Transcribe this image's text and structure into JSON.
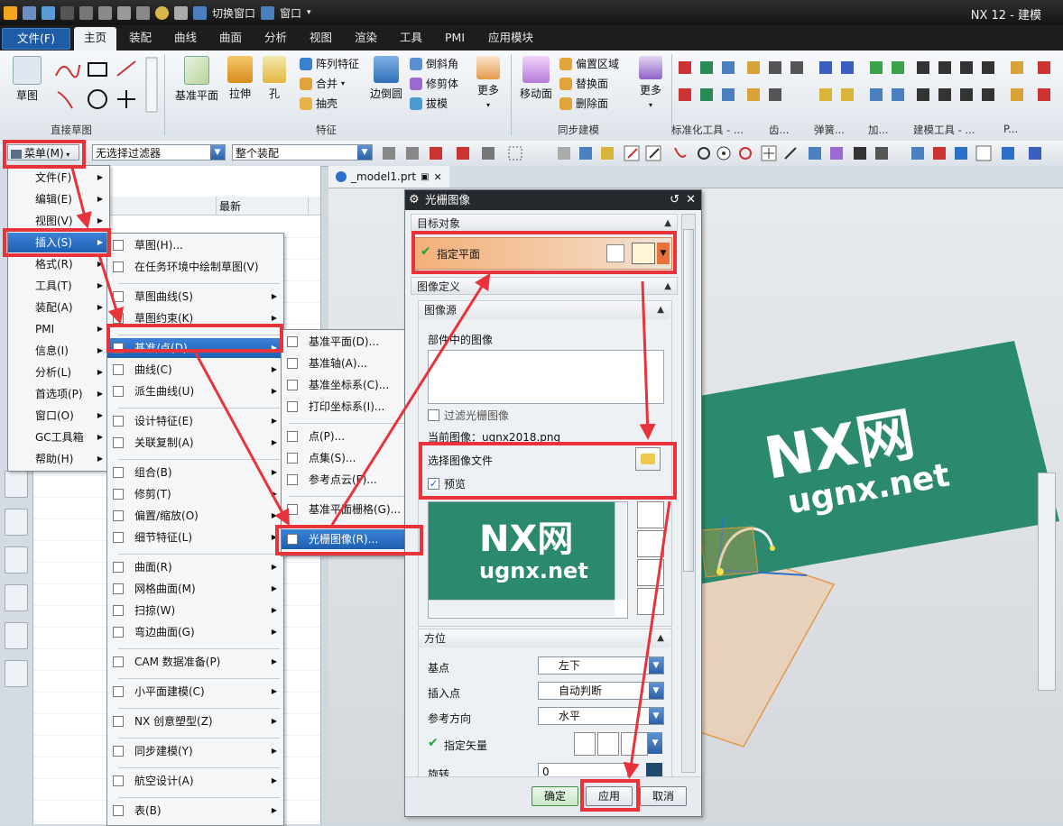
{
  "app": {
    "title": "NX 12 - 建模",
    "quick_access": {
      "switch_window": "切换窗口",
      "window": "窗口"
    }
  },
  "tabs": [
    "文件(F)",
    "主页",
    "装配",
    "曲线",
    "曲面",
    "分析",
    "视图",
    "渲染",
    "工具",
    "PMI",
    "应用模块"
  ],
  "ribbon": {
    "sketch": "草图",
    "datum_plane": "基准平面",
    "extrude": "拉伸",
    "hole": "孔",
    "pattern_feature": "阵列特征",
    "unite": "合并",
    "shell": "抽壳",
    "edge_blend": "边倒圆",
    "chamfer": "倒斜角",
    "trim_body": "修剪体",
    "draft": "拔模",
    "more": "更多",
    "move_face": "移动面",
    "offset_region": "偏置区域",
    "replace_face": "替换面",
    "delete_face": "删除面",
    "more2": "更多",
    "group_direct_sketch": "直接草图",
    "group_feature": "特征",
    "group_sync": "同步建模",
    "group_std": "标准化工具 - ...",
    "group_gear": "齿...",
    "group_spring": "弹簧...",
    "group_add": "加...",
    "group_build": "建模工具 - ...",
    "group_p": "P..."
  },
  "toolbar2": {
    "menu_button": "菜单(M)",
    "filter": "无选择过滤器",
    "scope": "整个装配"
  },
  "nav": {
    "col_latest": "最新"
  },
  "doc_tab": "_model1.prt",
  "menu_main": [
    {
      "label": "文件(F)",
      "arrow": true
    },
    {
      "label": "编辑(E)",
      "arrow": true
    },
    {
      "label": "视图(V)",
      "arrow": true
    },
    {
      "label": "插入(S)",
      "arrow": true,
      "highlight": true
    },
    {
      "label": "格式(R)",
      "arrow": true
    },
    {
      "label": "工具(T)",
      "arrow": true
    },
    {
      "label": "装配(A)",
      "arrow": true
    },
    {
      "label": "PMI",
      "arrow": true
    },
    {
      "label": "信息(I)",
      "arrow": true
    },
    {
      "label": "分析(L)",
      "arrow": true
    },
    {
      "label": "首选项(P)",
      "arrow": true
    },
    {
      "label": "窗口(O)",
      "arrow": true
    },
    {
      "label": "GC工具箱",
      "arrow": true
    },
    {
      "label": "帮助(H)",
      "arrow": true
    }
  ],
  "menu_insert": [
    {
      "label": "草图(H)...",
      "arrow": false
    },
    {
      "label": "在任务环境中绘制草图(V)",
      "arrow": false
    },
    {
      "label": "草图曲线(S)",
      "arrow": true
    },
    {
      "label": "草图约束(K)",
      "arrow": true
    },
    {
      "label": "基准/点(D)",
      "arrow": true,
      "highlight": true
    },
    {
      "label": "曲线(C)",
      "arrow": true
    },
    {
      "label": "派生曲线(U)",
      "arrow": true
    },
    {
      "label": "设计特征(E)",
      "arrow": true
    },
    {
      "label": "关联复制(A)",
      "arrow": true
    },
    {
      "label": "组合(B)",
      "arrow": true
    },
    {
      "label": "修剪(T)",
      "arrow": true
    },
    {
      "label": "偏置/缩放(O)",
      "arrow": true
    },
    {
      "label": "细节特征(L)",
      "arrow": true
    },
    {
      "label": "曲面(R)",
      "arrow": true
    },
    {
      "label": "网格曲面(M)",
      "arrow": true
    },
    {
      "label": "扫掠(W)",
      "arrow": true
    },
    {
      "label": "弯边曲面(G)",
      "arrow": true
    },
    {
      "label": "CAM 数据准备(P)",
      "arrow": true
    },
    {
      "label": "小平面建模(C)",
      "arrow": true
    },
    {
      "label": "NX 创意塑型(Z)",
      "arrow": true
    },
    {
      "label": "同步建模(Y)",
      "arrow": true
    },
    {
      "label": "航空设计(A)",
      "arrow": true
    },
    {
      "label": "表(B)",
      "arrow": true
    }
  ],
  "menu_datum": [
    {
      "label": "基准平面(D)..."
    },
    {
      "label": "基准轴(A)..."
    },
    {
      "label": "基准坐标系(C)..."
    },
    {
      "label": "打印坐标系(I)..."
    },
    {
      "label": "点(P)..."
    },
    {
      "label": "点集(S)..."
    },
    {
      "label": "参考点云(F)..."
    },
    {
      "label": "基准平面栅格(G)..."
    },
    {
      "label": "光栅图像(R)...",
      "highlight": true
    }
  ],
  "dialog": {
    "title": "光栅图像",
    "sec_target": "目标对象",
    "specify_plane": "指定平面",
    "sec_image_def": "图像定义",
    "sec_image_source": "图像源",
    "images_in_part": "部件中的图像",
    "filter_raster": "过滤光栅图像",
    "current_image": "当前图像：ugnx2018.png",
    "select_image_file": "选择图像文件",
    "preview": "预览",
    "sec_orientation": "方位",
    "base_point_label": "基点",
    "base_point_value": "左下",
    "insert_point_label": "插入点",
    "insert_point_value": "自动判断",
    "ref_dir_label": "参考方向",
    "ref_dir_value": "水平",
    "specify_vector": "指定矢量",
    "rotation_label": "旋转",
    "rotation_value": "0",
    "ok": "确定",
    "apply": "应用",
    "cancel": "取消"
  },
  "logo": {
    "line1": "NX网",
    "line2": "ugnx.net"
  },
  "colors": {
    "accent_red": "#e8333b",
    "logo_green": "#2b8a6e",
    "menu_highlight": "#2a6fc8"
  }
}
